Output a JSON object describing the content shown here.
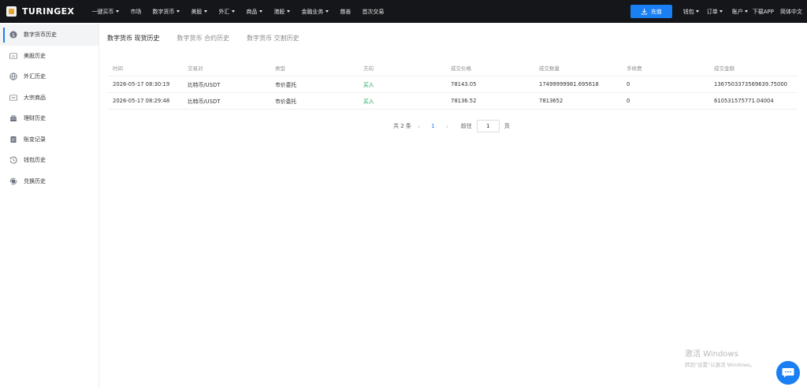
{
  "brand": {
    "name": "TURINGEX"
  },
  "nav": {
    "items": [
      {
        "label": "一键买币",
        "dropdown": true
      },
      {
        "label": "市场",
        "dropdown": false
      },
      {
        "label": "数字货币",
        "dropdown": true
      },
      {
        "label": "美股",
        "dropdown": true
      },
      {
        "label": "外汇",
        "dropdown": true
      },
      {
        "label": "商品",
        "dropdown": true
      },
      {
        "label": "港股",
        "dropdown": true
      },
      {
        "label": "金融业务",
        "dropdown": true
      },
      {
        "label": "慈善",
        "dropdown": false
      },
      {
        "label": "首次交易",
        "dropdown": false
      }
    ],
    "recharge_label": "充值",
    "wallet_label": "钱包",
    "orders_label": "订单",
    "account_label": "账户",
    "download_label": "下载APP",
    "language_label": "简体中文"
  },
  "sidebar": {
    "items": [
      {
        "label": "数字货币历史",
        "icon": "coin-icon",
        "active": true
      },
      {
        "label": "美股历史",
        "icon": "us-stock-icon"
      },
      {
        "label": "外汇历史",
        "icon": "globe-icon"
      },
      {
        "label": "大宗商品",
        "icon": "commodity-icon"
      },
      {
        "label": "理财历史",
        "icon": "finance-icon"
      },
      {
        "label": "账变记录",
        "icon": "ledger-icon"
      },
      {
        "label": "钱包历史",
        "icon": "wallet-history-icon"
      },
      {
        "label": "兑换历史",
        "icon": "exchange-icon"
      }
    ]
  },
  "tabs": [
    {
      "label": "数字货币 现货历史",
      "active": true
    },
    {
      "label": "数字货币 合约历史",
      "active": false
    },
    {
      "label": "数字货币 交割历史",
      "active": false
    }
  ],
  "table": {
    "headers": [
      "时间",
      "交易对",
      "类型",
      "方向",
      "成交价格",
      "成交数量",
      "手续费",
      "成交金额"
    ],
    "rows": [
      [
        "2026-05-17 08:30:19",
        "比特币/USDT",
        "市价委托",
        "买入",
        "78143.05",
        "17499999981.695618",
        "0",
        "1367503373569639.75000"
      ],
      [
        "2026-05-17 08:29:48",
        "比特币/USDT",
        "市价委托",
        "买入",
        "78136.52",
        "7813652",
        "0",
        "610531575771.04004"
      ]
    ]
  },
  "pagination": {
    "total_label": "共 2 条",
    "current_page": "1",
    "goto_label": "前往",
    "input_value": "1",
    "page_suffix": "页"
  },
  "watermark": {
    "line1": "激活 Windows",
    "line2": "转到\"设置\"以激活 Windows。"
  },
  "colors": {
    "accent": "#1a7ff2",
    "buy": "#19a55a",
    "topbar": "#15161a"
  }
}
